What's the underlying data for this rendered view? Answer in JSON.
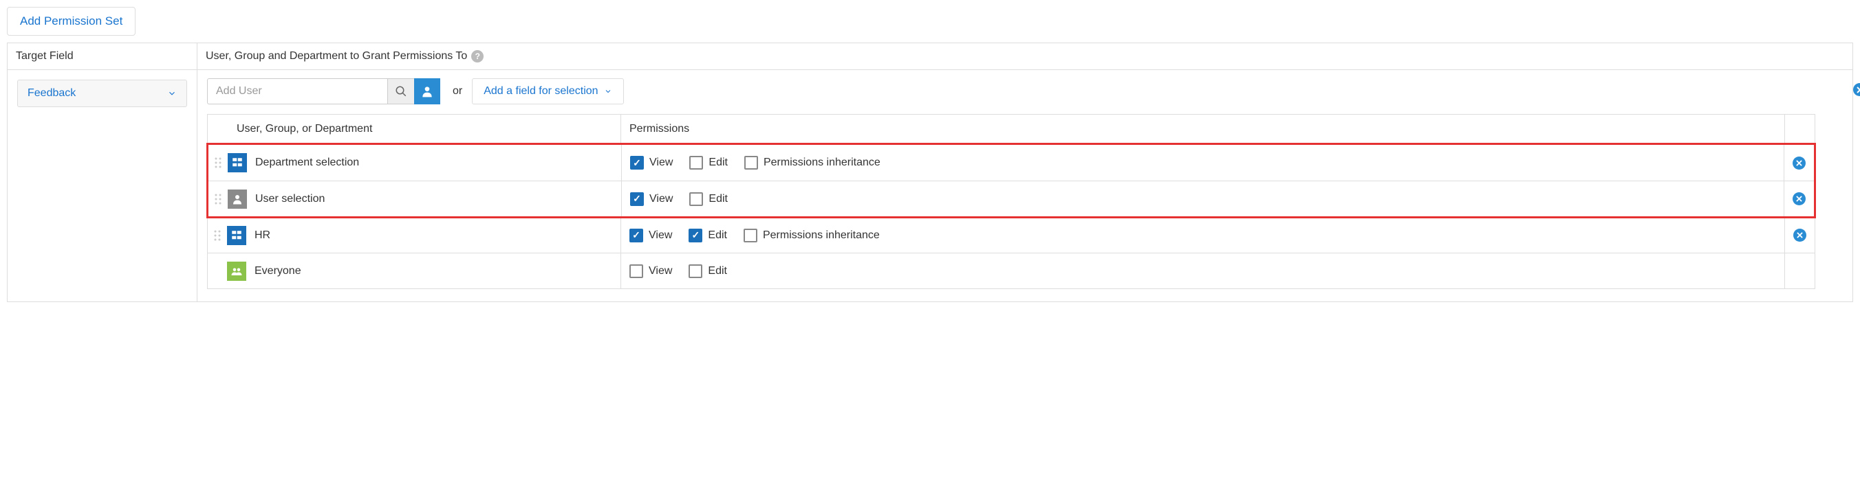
{
  "buttons": {
    "add_permission_set": "Add Permission Set",
    "add_field_for_selection": "Add a field for selection"
  },
  "headers": {
    "target_field": "Target Field",
    "grant_to": "User, Group and Department to Grant Permissions To"
  },
  "target_field_selector": {
    "selected": "Feedback"
  },
  "user_search": {
    "placeholder": "Add User",
    "or": "or"
  },
  "table": {
    "col_entity": "User, Group, or Department",
    "col_permissions": "Permissions"
  },
  "perm_labels": {
    "view": "View",
    "edit": "Edit",
    "inherit": "Permissions inheritance"
  },
  "rows": [
    {
      "label": "Department selection",
      "icon": "dept",
      "view": true,
      "edit": false,
      "inherit": false,
      "has_inherit": true,
      "deletable": true,
      "draggable": true,
      "highlighted": true
    },
    {
      "label": "User selection",
      "icon": "user",
      "view": true,
      "edit": false,
      "has_inherit": false,
      "deletable": true,
      "draggable": true,
      "highlighted": true
    },
    {
      "label": "HR",
      "icon": "dept",
      "view": true,
      "edit": true,
      "inherit": false,
      "has_inherit": true,
      "deletable": true,
      "draggable": true,
      "highlighted": false
    },
    {
      "label": "Everyone",
      "icon": "everyone",
      "view": false,
      "edit": false,
      "has_inherit": false,
      "deletable": false,
      "draggable": false,
      "highlighted": false
    }
  ]
}
